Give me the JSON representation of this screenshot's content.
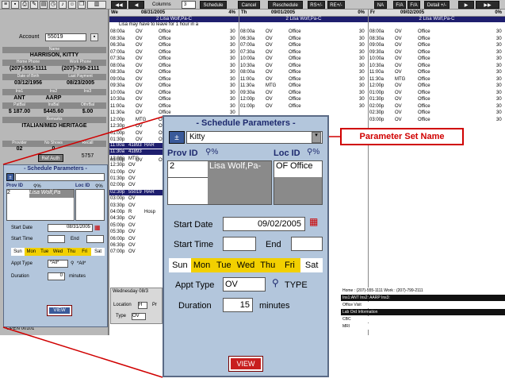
{
  "toolbar": {
    "icons": [
      "list-icon",
      "save-icon",
      "printer-icon",
      "tools-icon",
      "chart-icon",
      "clock-icon",
      "bell-icon",
      "person-icon",
      "copy-icon",
      "columns-icon"
    ],
    "nav_first": "◀◀",
    "nav_prev": "◀",
    "columns_label": "Columns",
    "columns_value": "3",
    "schedule_btn": "Schedule",
    "cancel_btn": "Cancel",
    "reschedule_btn": "Reschedule",
    "rsa_btn": "RS+/-",
    "rea_btn": "RE+/-",
    "na_btn": "NA",
    "fa1_btn": "F/A",
    "fa2_btn": "F/A",
    "detail_btn": "Detail +/-",
    "nav_next": "▶",
    "nav_last": "▶▶"
  },
  "patient": {
    "account_label": "Account",
    "account": "55019",
    "name_label": "Name",
    "name": "HARRISON, KITTY",
    "home_phone_label": "Home Phone",
    "home_phone": "(207)-555-1111",
    "work_phone_label": "Work Phone",
    "work_phone": "(207)-799-2111",
    "dob_label": "Date of Birth",
    "dob": "03/12/1956",
    "last_payment_label": "Last Payment",
    "last_payment": "08/23/2005",
    "ins1_label": "Ins1",
    "ins1": "ANT",
    "ins2_label": "Ins2",
    "ins2": "AARP",
    "ins3_label": "Ins3",
    "patbal_label": "PatBal",
    "patbal": "$ 187.00",
    "insbal_label": "InsBal",
    "insbal": "$445.60",
    "othbal_label": "OthrBal",
    "othbal": "$.00",
    "remarks_label": "Remarks",
    "remarks": "ITALIAN/MED HERITAGE",
    "provider_label": "Provider",
    "provider": "02",
    "no_shows_label": "No Shows",
    "no_shows": "0",
    "recall_label": "Recall",
    "recall": "5757",
    "ref_auth": "Ref Auth",
    "status": "OPEN 00101"
  },
  "small_params": {
    "title": "- Schedule Parameters -",
    "plus": "±",
    "selection": "",
    "prov_label": "Prov ID",
    "loc_label": "Loc ID",
    "prov_id": "2",
    "prov_name": "Lisa Wolf,Pa",
    "start_date_label": "Start Date",
    "start_date": "08/31/2005",
    "start_time_label": "Start Time",
    "end_label": "End",
    "days": [
      "Sun",
      "Mon",
      "Tue",
      "Wed",
      "Thu",
      "Fri",
      "Sat"
    ],
    "appt_type_label": "Appt Type",
    "appt_type": "*All*",
    "appt_type_desc": "*All*",
    "duration_label": "Duration",
    "duration": "0",
    "minutes": "minutes",
    "view": "VIEW"
  },
  "params": {
    "title": "- Schedule Parameters -",
    "plus": "±",
    "selection": "Kitty",
    "prov_label": "Prov ID",
    "loc_label": "Loc ID",
    "prov_id": "2",
    "prov_name": "Lisa Wolf,Pa-",
    "loc_id": "OF",
    "loc_name": "Office",
    "start_date_label": "Start Date",
    "start_date": "09/02/2005",
    "start_time_label": "Start Time",
    "end_label": "End",
    "days": [
      "Sun",
      "Mon",
      "Tue",
      "Wed",
      "Thu",
      "Fri",
      "Sat"
    ],
    "appt_type_label": "Appt Type",
    "appt_type": "OV",
    "type_label": "TYPE",
    "duration_label": "Duration",
    "duration": "15",
    "minutes": "minutes",
    "view": "VIEW"
  },
  "callout": {
    "label": "Parameter Set Name"
  },
  "columns": [
    {
      "day": "We",
      "date": "08/31/2005",
      "pct": "4%",
      "provider": "2 Lisa Wolf,Pa-C",
      "note": "Lisa may have to leave for 1 hour in a"
    },
    {
      "day": "Th",
      "date": "09/01/2005",
      "pct": "0%",
      "provider": "2 Lisa Wolf,Pa-C",
      "note": ""
    },
    {
      "day": "Fr",
      "date": "09/02/2005",
      "pct": "0%",
      "provider": "2 Lisa Wolf,Pa-C",
      "note": ""
    }
  ],
  "col1_rows": [
    [
      "08:00a",
      "OV",
      "Office",
      "30"
    ],
    [
      "08:30a",
      "OV",
      "Office",
      "30"
    ],
    [
      "06:30a",
      "OV",
      "Office",
      "30"
    ],
    [
      "07:00a",
      "OV",
      "Office",
      "30"
    ],
    [
      "07:30a",
      "OV",
      "Office",
      "30"
    ],
    [
      "08:00a",
      "OV",
      "Office",
      "30"
    ],
    [
      "08:30a",
      "OV",
      "Office",
      "30"
    ],
    [
      "09:00a",
      "OV",
      "Office",
      "30"
    ],
    [
      "09:30a",
      "OV",
      "Office",
      "30"
    ],
    [
      "10:00a",
      "OV",
      "Office",
      "30"
    ],
    [
      "10:30a",
      "OV",
      "Office",
      "30"
    ],
    [
      "11:00a",
      "OV",
      "Office",
      "30"
    ],
    [
      "11:30a",
      "OV",
      "Office",
      "30"
    ],
    [
      "12:00p",
      "MTG",
      "Office",
      "30"
    ],
    [
      "12:30p",
      "OV",
      "Office",
      "30"
    ],
    [
      "01:00p",
      "OV",
      "Office",
      "30"
    ],
    [
      "01:30p",
      "OV",
      "Office",
      "30"
    ],
    [
      "02:00p",
      "OV",
      "Office",
      "30"
    ],
    [
      "02:30p",
      "OV",
      "Office",
      "30"
    ],
    [
      "03:00p",
      "OV",
      "Office",
      "30"
    ]
  ],
  "col2_rows": [
    [
      "08:00a",
      "OV",
      "Office",
      "30"
    ],
    [
      "06:30a",
      "OV",
      "Office",
      "30"
    ],
    [
      "07:00a",
      "OV",
      "Office",
      "30"
    ],
    [
      "07:30a",
      "OV",
      "Office",
      "30"
    ],
    [
      "10:00a",
      "OV",
      "Office",
      "30"
    ],
    [
      "10:30a",
      "OV",
      "Office",
      "30"
    ],
    [
      "08:00a",
      "OV",
      "Office",
      "30"
    ],
    [
      "11:00a",
      "OV",
      "Office",
      "30"
    ],
    [
      "11:30a",
      "MTG",
      "Office",
      "30"
    ],
    [
      "09:30a",
      "OV",
      "Office",
      "30"
    ],
    [
      "12:00p",
      "OV",
      "Office",
      "30"
    ],
    [
      "01:00p",
      "OV",
      "Office",
      "30"
    ]
  ],
  "col3_rows": [
    [
      "08:00a",
      "OV",
      "Office",
      "30"
    ],
    [
      "08:30a",
      "OV",
      "Office",
      "30"
    ],
    [
      "09:00a",
      "OV",
      "Office",
      "30"
    ],
    [
      "09:30a",
      "OV",
      "Office",
      "30"
    ],
    [
      "10:00a",
      "OV",
      "Office",
      "30"
    ],
    [
      "10:30a",
      "OV",
      "Office",
      "30"
    ],
    [
      "11:00a",
      "OV",
      "Office",
      "30"
    ],
    [
      "11:30a",
      "MTG",
      "Office",
      "30"
    ],
    [
      "12:00p",
      "OV",
      "Office",
      "30"
    ],
    [
      "01:00p",
      "OV",
      "Office",
      "30"
    ],
    [
      "01:30p",
      "OV",
      "Office",
      "30"
    ],
    [
      "02:00p",
      "OV",
      "Office",
      "30"
    ],
    [
      "02:30p",
      "OV",
      "Office",
      "30"
    ],
    [
      "03:00p",
      "OV",
      "Office",
      "30"
    ]
  ],
  "col1_lower": [
    [
      "11:00a",
      "41893",
      "HAR"
    ],
    [
      "11:30a",
      "41893",
      ""
    ],
    [
      "12:00p",
      "MTG",
      ""
    ],
    [
      "12:30p",
      "OV",
      ""
    ],
    [
      "01:00p",
      "OV",
      ""
    ],
    [
      "01:30p",
      "OV",
      ""
    ],
    [
      "02:00p",
      "OV",
      ""
    ],
    [
      "02:30p",
      "55019",
      "HAR"
    ],
    [
      "03:00p",
      "OV",
      ""
    ],
    [
      "03:30p",
      "OV",
      ""
    ],
    [
      "04:00p",
      "R",
      "Hosp"
    ],
    [
      "04:30p",
      "OV",
      ""
    ],
    [
      "05:00p",
      "OV",
      ""
    ],
    [
      "05:30p",
      "OV",
      ""
    ],
    [
      "06:00p",
      "OV",
      ""
    ],
    [
      "06:30p",
      "OV",
      ""
    ],
    [
      "07:00p",
      "OV",
      ""
    ]
  ],
  "appt_detail": {
    "date": "Wednesday 08/3",
    "location_label": "Location",
    "location": "H",
    "pr": "Pr",
    "type_label": "Type",
    "type": "OV"
  },
  "bottom_info": {
    "phones": "Home : (207)-555-1111    Work : (207)-799-2111",
    "ins": "Ins1:ANT  Ins2: AARP  Ins3:",
    "office_visit": "Office Visit",
    "lab": "Lab Ord Information",
    "cbc": "CBC",
    "mri": "MRI"
  },
  "colors": {
    "accent_red": "#d00000",
    "panel_blue": "#b3c6dc",
    "title_navy": "#1e2a6e",
    "day_yellow": "#f2d000",
    "header_navy": "#1e1e6e"
  }
}
